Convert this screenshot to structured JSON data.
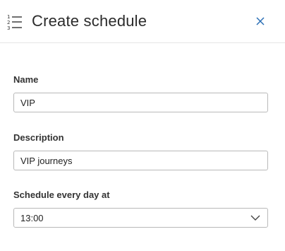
{
  "header": {
    "title": "Create schedule",
    "icon": "numbered-list-icon",
    "close_icon": "close-icon"
  },
  "form": {
    "name": {
      "label": "Name",
      "value": "VIP"
    },
    "description": {
      "label": "Description",
      "value": "VIP journeys"
    },
    "schedule": {
      "label": "Schedule every day at",
      "value": "13:00",
      "icon": "chevron-down-icon"
    }
  },
  "colors": {
    "accent": "#2a6fb5",
    "border": "#b9b9b9",
    "divider": "#e6e6e6"
  }
}
